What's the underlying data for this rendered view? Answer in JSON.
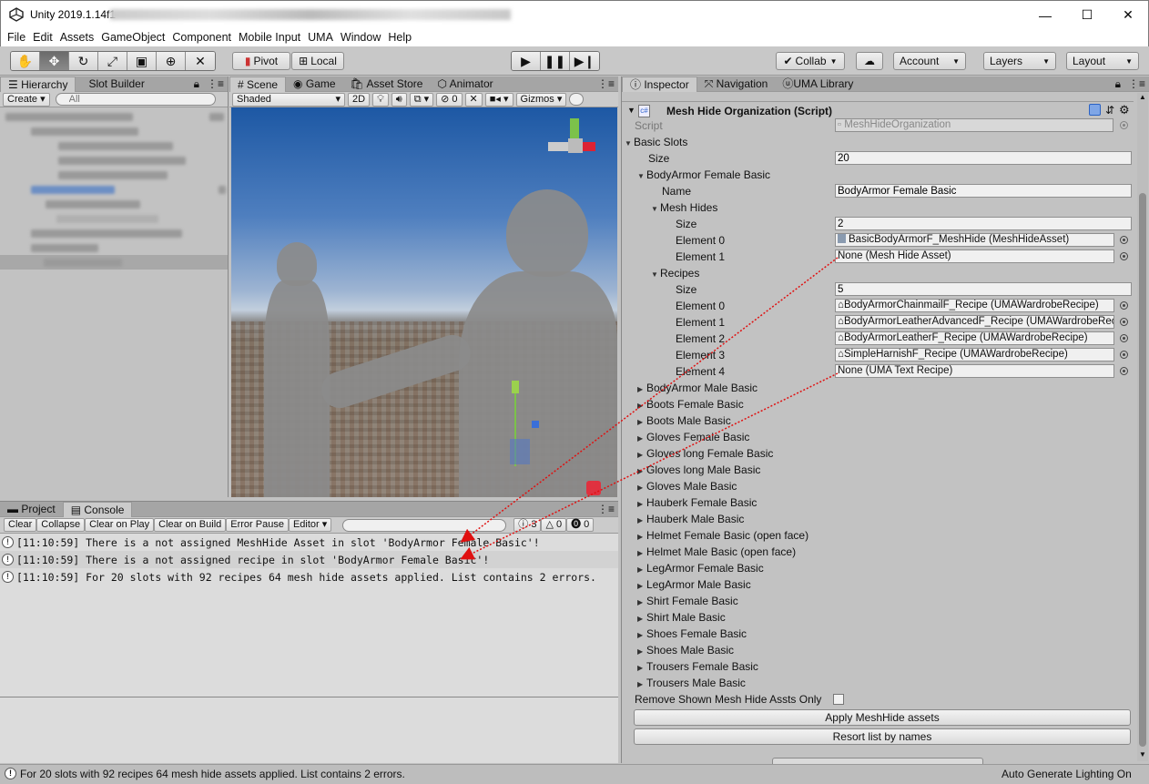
{
  "window": {
    "title": "Unity 2019.1.14f1",
    "minimize": "—",
    "maximize": "☐",
    "close": "✕"
  },
  "menu": [
    "File",
    "Edit",
    "Assets",
    "GameObject",
    "Component",
    "Mobile Input",
    "UMA",
    "Window",
    "Help"
  ],
  "toolbar": {
    "pivot": "Pivot",
    "local": "Local",
    "collab": "Collab",
    "account": "Account",
    "layers": "Layers",
    "layout": "Layout"
  },
  "hierarchy": {
    "tabs": [
      "Hierarchy",
      "Slot Builder"
    ],
    "create": "Create",
    "search_placeholder": "All"
  },
  "scene": {
    "tabs": [
      "Scene",
      "Game",
      "Asset Store",
      "Animator"
    ],
    "shading": "Shaded",
    "mode2d": "2D",
    "gizmos": "Gizmos",
    "fx_count": "0"
  },
  "console": {
    "tabs": [
      "Project",
      "Console"
    ],
    "buttons": [
      "Clear",
      "Collapse",
      "Clear on Play",
      "Clear on Build",
      "Error Pause",
      "Editor"
    ],
    "counts": {
      "logs": "3",
      "warnings": "0",
      "errors": "0"
    },
    "rows": [
      "[11:10:59] There is a not assigned MeshHide Asset in slot 'BodyArmor Female Basic'!",
      "[11:10:59] There is a not assigned recipe in slot 'BodyArmor Female Basic'!",
      "[11:10:59] For 20 slots with 92 recipes 64 mesh hide assets applied. List contains 2 errors."
    ]
  },
  "inspector": {
    "tabs": [
      "Inspector",
      "Navigation",
      "UMA Library"
    ],
    "component_title": "Mesh Hide Organization (Script)",
    "script_label": "Script",
    "script_value": "MeshHideOrganization",
    "basic_slots": "Basic Slots",
    "size_label": "Size",
    "size_value": "20",
    "expanded": {
      "label": "BodyArmor Female Basic",
      "name_label": "Name",
      "name_value": "BodyArmor Female Basic",
      "mesh_hides": "Mesh Hides",
      "mesh_size": "2",
      "mesh_elements": [
        {
          "label": "Element 0",
          "value": "BasicBodyArmorF_MeshHide (MeshHideAsset)"
        },
        {
          "label": "Element 1",
          "value": "None (Mesh Hide Asset)"
        }
      ],
      "recipes": "Recipes",
      "recipes_size": "5",
      "recipe_elements": [
        {
          "label": "Element 0",
          "value": "BodyArmorChainmailF_Recipe (UMAWardrobeRecipe)"
        },
        {
          "label": "Element 1",
          "value": "BodyArmorLeatherAdvancedF_Recipe (UMAWardrobeRecipe)"
        },
        {
          "label": "Element 2",
          "value": "BodyArmorLeatherF_Recipe (UMAWardrobeRecipe)"
        },
        {
          "label": "Element 3",
          "value": "SimpleHarnishF_Recipe (UMAWardrobeRecipe)"
        },
        {
          "label": "Element 4",
          "value": "None (UMA Text Recipe)"
        }
      ]
    },
    "collapsed_slots": [
      "BodyArmor Male Basic",
      "Boots Female Basic",
      "Boots Male Basic",
      "Gloves Female Basic",
      "Gloves long Female Basic",
      "Gloves long Male Basic",
      "Gloves Male Basic",
      "Hauberk Female Basic",
      "Hauberk Male Basic",
      "Helmet Female Basic (open face)",
      "Helmet Male Basic (open face)",
      "LegArmor Female Basic",
      "LegArmor Male Basic",
      "Shirt Female Basic",
      "Shirt Male Basic",
      "Shoes Female Basic",
      "Shoes Male Basic",
      "Trousers Female Basic",
      "Trousers Male Basic"
    ],
    "remove_toggle_label": "Remove Shown Mesh Hide Assts Only",
    "apply_button": "Apply MeshHide assets",
    "resort_button": "Resort list by names"
  },
  "status": {
    "message": "For 20 slots with 92 recipes 64 mesh hide assets applied. List contains 2 errors.",
    "right": "Auto Generate Lighting On"
  },
  "colors": {
    "annotation_arrow": "#e01010",
    "selection": "#3d7ad8"
  }
}
